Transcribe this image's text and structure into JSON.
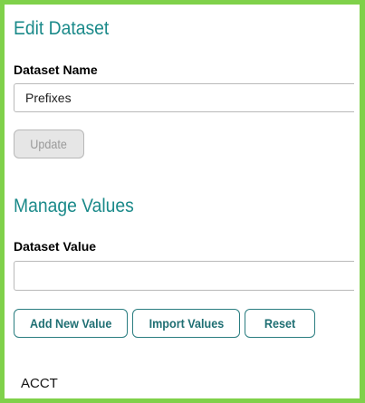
{
  "edit_dataset": {
    "heading": "Edit Dataset",
    "name_label": "Dataset Name",
    "name_value": "Prefixes",
    "update_label": "Update"
  },
  "manage_values": {
    "heading": "Manage Values",
    "value_label": "Dataset Value",
    "value_input": "",
    "add_label": "Add New Value",
    "import_label": "Import Values",
    "reset_label": "Reset"
  },
  "values_list": {
    "items": [
      "ACCT"
    ]
  },
  "colors": {
    "frame_border": "#7fd14a",
    "heading": "#1b8a8a",
    "button_border": "#2a7d80",
    "button_text": "#1f6f73"
  }
}
